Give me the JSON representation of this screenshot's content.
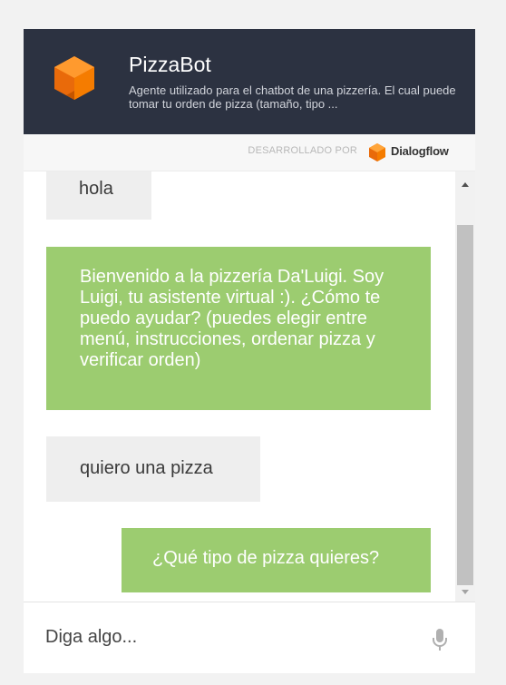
{
  "header": {
    "title": "PizzaBot",
    "description": "Agente utilizado para el chatbot de una pizzería. El cual puede tomar tu orden de pizza (tamaño, tipo ...",
    "logo_icon": "dialogflow-logo-icon"
  },
  "powered_by": {
    "label": "DESARROLLADO POR",
    "brand": "Dialogflow",
    "brand_icon": "dialogflow-logo-icon"
  },
  "messages": [
    {
      "from": "user",
      "text": "hola"
    },
    {
      "from": "bot",
      "text": "Bienvenido a la pizzería Da'Luigi. Soy Luigi, tu asistente virtual :). ¿Cómo te puedo ayudar? (puedes elegir entre menú, instrucciones, ordenar pizza y verificar orden)"
    },
    {
      "from": "user",
      "text": "quiero una pizza"
    },
    {
      "from": "bot",
      "text": "¿Qué tipo de pizza quieres?"
    }
  ],
  "input": {
    "placeholder": "Diga algo...",
    "value": "",
    "mic_icon": "microphone-icon"
  },
  "colors": {
    "header_bg": "#2c3241",
    "logo_orange": "#f57c00",
    "bot_bubble": "#9ccc70",
    "user_bubble": "#eeeeee"
  }
}
